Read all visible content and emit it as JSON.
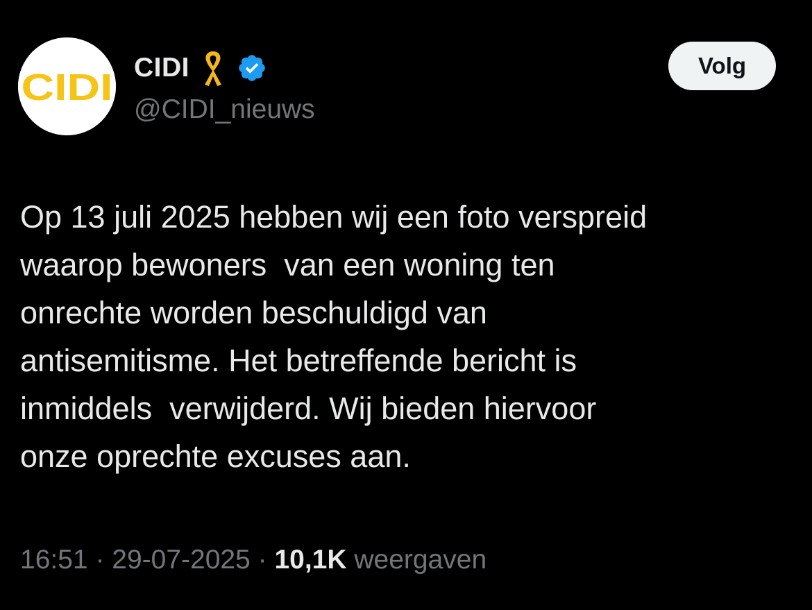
{
  "account": {
    "display_name": "CIDI",
    "handle": "@CIDI_nieuws",
    "avatar_text": "CIDI",
    "verified": true
  },
  "follow_button": {
    "label": "Volg"
  },
  "tweet": {
    "lines": [
      "Op 13 juli 2025 hebben wij een foto verspreid",
      "waarop bewoners  van een woning ten",
      "onrechte worden beschuldigd van",
      "antisemitisme. Het betreffende bericht is",
      "inmiddels  verwijderd. Wij bieden hiervoor",
      "onze oprechte excuses aan."
    ]
  },
  "meta": {
    "time": "16:51",
    "separator": " · ",
    "date": "29-07-2025",
    "views_count": "10,1K",
    "views_label": "weergaven"
  },
  "colors": {
    "background": "#000000",
    "primary_text": "#e7e9ea",
    "secondary_text": "#71767b",
    "verified_blue": "#1d9bf0",
    "ribbon_yellow": "#f4b81c",
    "logo_yellow": "#f6c416",
    "follow_bg": "#eff3f4"
  },
  "icons": {
    "ribbon": "yellow-ribbon-icon",
    "verified": "verified-badge-icon"
  }
}
